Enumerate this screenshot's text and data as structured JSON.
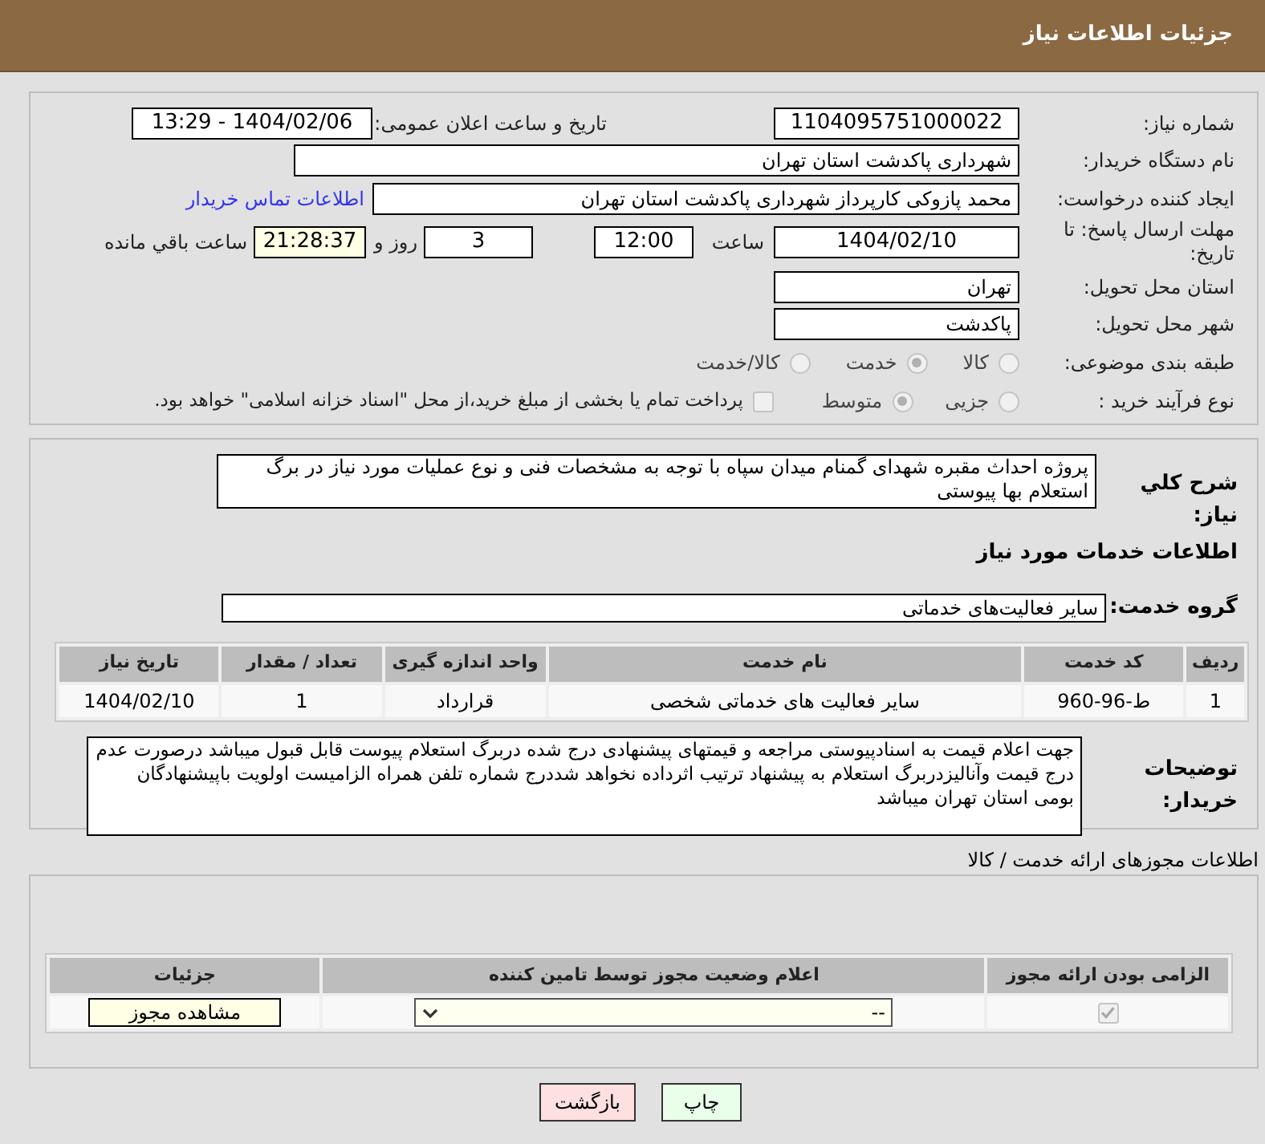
{
  "header": {
    "title": "جزئیات اطلاعات نیاز"
  },
  "need_number": {
    "label": "شماره نیاز:",
    "value": "1104095751000022"
  },
  "announce": {
    "label": "تاریخ و ساعت اعلان عمومی:",
    "value": "1404/02/06 - 13:29"
  },
  "buyer_org": {
    "label": "نام دستگاه خریدار:",
    "value": "شهرداری پاکدشت استان تهران"
  },
  "creator": {
    "label": "ایجاد کننده درخواست:",
    "value": "محمد پازوکی کارپرداز شهرداری پاکدشت استان تهران",
    "link": "اطلاعات تماس خریدار"
  },
  "deadline": {
    "label": "مهلت ارسال پاسخ: تا تاریخ:",
    "date": "1404/02/10",
    "time_label": "ساعت",
    "time": "12:00",
    "days": "3",
    "days_label": "روز و",
    "remaining": "21:28:37",
    "remaining_label": "ساعت باقي مانده"
  },
  "province": {
    "label": "استان محل تحویل:",
    "value": "تهران"
  },
  "city": {
    "label": "شهر محل تحویل:",
    "value": "پاکدشت"
  },
  "category": {
    "label": "طبقه بندی موضوعی:",
    "options": [
      {
        "label": "کالا",
        "selected": false
      },
      {
        "label": "خدمت",
        "selected": true
      },
      {
        "label": "کالا/خدمت",
        "selected": false
      }
    ]
  },
  "process": {
    "label": "نوع فرآیند خرید :",
    "options": [
      {
        "label": "جزیی",
        "selected": false
      },
      {
        "label": "متوسط",
        "selected": true
      }
    ],
    "payment": {
      "checked": false,
      "text": "پرداخت تمام یا بخشی از مبلغ خرید،از محل \"اسناد خزانه اسلامی\" خواهد بود."
    }
  },
  "description": {
    "label": "شرح کلي نیاز:",
    "value": "پروژه احداث مقبره شهدای گمنام میدان سپاه با توجه به مشخصات فنی و نوع عملیات مورد نیاز در برگ استعلام بها پیوستی"
  },
  "services_title": "اطلاعات خدمات مورد نیاز",
  "service_group": {
    "label": "گروه خدمت:",
    "value": "سایر فعالیت‌های خدماتی"
  },
  "services_table": {
    "columns": [
      "ردیف",
      "کد خدمت",
      "نام خدمت",
      "واحد اندازه گیری",
      "تعداد / مقدار",
      "تاریخ نیاز"
    ],
    "rows": [
      [
        "1",
        "ط-96-960",
        "سایر فعالیت های خدماتی شخصی",
        "قرارداد",
        "1",
        "1404/02/10"
      ]
    ]
  },
  "buyer_notes": {
    "label": "توضیحات خریدار:",
    "value": "جهت اعلام قیمت به اسنادپیوستی مراجعه و قیمتهای پیشنهادی درج شده دربرگ استعلام پیوست قابل قبول میباشد درصورت عدم درج قیمت وآنالیزدربرگ استعلام به پیشنهاد ترتیب اثرداده نخواهد شددرج شماره تلفن همراه الزامیست اولویت باپیشنهادگان بومی استان تهران میباشد"
  },
  "permits": {
    "title": "اطلاعات مجوزهای ارائه خدمت / کالا",
    "columns": [
      "الزامی بودن ارائه مجوز",
      "اعلام وضعیت مجوز توسط تامین کننده",
      "جزئیات"
    ],
    "rows": [
      {
        "required": true,
        "status": "--",
        "details": "مشاهده مجوز"
      }
    ]
  },
  "buttons": [
    {
      "kind": "print",
      "label": "چاپ"
    },
    {
      "kind": "back",
      "label": "بازگشت"
    }
  ]
}
